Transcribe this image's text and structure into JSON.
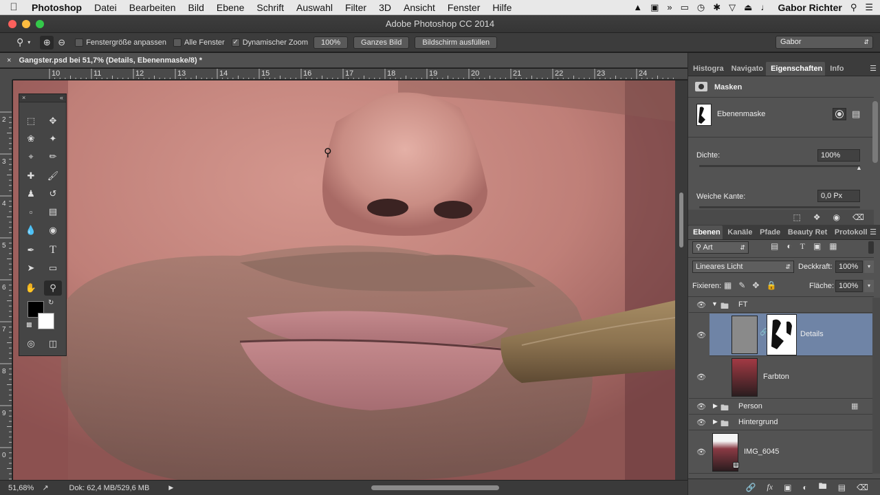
{
  "menubar": {
    "apple": "",
    "app": "Photoshop",
    "items": [
      "Datei",
      "Bearbeiten",
      "Bild",
      "Ebene",
      "Schrift",
      "Auswahl",
      "Filter",
      "3D",
      "Ansicht",
      "Fenster",
      "Hilfe"
    ],
    "user": "Gabor Richter"
  },
  "window": {
    "title": "Adobe Photoshop CC 2014"
  },
  "options": {
    "resize_windows": "Fenstergröße anpassen",
    "all_windows": "Alle Fenster",
    "scrubby_zoom": "Dynamischer Zoom",
    "zoom_value": "100%",
    "fit_screen": "Ganzes Bild",
    "fill_screen": "Bildschirm ausfüllen",
    "workspace": "Gabor"
  },
  "document": {
    "tab_title": "Gangster.psd bei 51,7% (Details, Ebenenmaske/8) *",
    "ruler_h": [
      "10",
      "11",
      "12",
      "13",
      "14",
      "15",
      "16",
      "17",
      "18",
      "19",
      "20",
      "21",
      "22",
      "23",
      "24"
    ],
    "ruler_v": [
      "2",
      "3",
      "4",
      "5",
      "6",
      "7",
      "8",
      "9",
      "0"
    ]
  },
  "status": {
    "zoom": "51,68%",
    "doc_size": "Dok: 62,4 MB/529,6 MB"
  },
  "props_panel": {
    "tabs": [
      "Histogra",
      "Navigato",
      "Eigenschaften",
      "Info"
    ],
    "active_tab": "Eigenschaften",
    "section_title": "Masken",
    "mask_label": "Ebenenmaske",
    "density_label": "Dichte:",
    "density_value": "100%",
    "feather_label": "Weiche Kante:",
    "feather_value": "0,0 Px"
  },
  "layers_panel": {
    "tabs": [
      "Ebenen",
      "Kanäle",
      "Pfade",
      "Beauty Ret",
      "Protokoll"
    ],
    "active_tab": "Ebenen",
    "filter_label": "Art",
    "blend_mode": "Lineares Licht",
    "opacity_label": "Deckkraft:",
    "opacity_value": "100%",
    "lock_label": "Fixieren:",
    "fill_label": "Fläche:",
    "fill_value": "100%",
    "layers": [
      {
        "name": "FT",
        "kind": "group-open"
      },
      {
        "name": "Details",
        "kind": "layer-mask",
        "selected": true
      },
      {
        "name": "Farbton",
        "kind": "image"
      },
      {
        "name": "Person",
        "kind": "group-closed"
      },
      {
        "name": "Hintergrund",
        "kind": "group-closed"
      },
      {
        "name": "IMG_6045",
        "kind": "smart-object"
      }
    ]
  }
}
